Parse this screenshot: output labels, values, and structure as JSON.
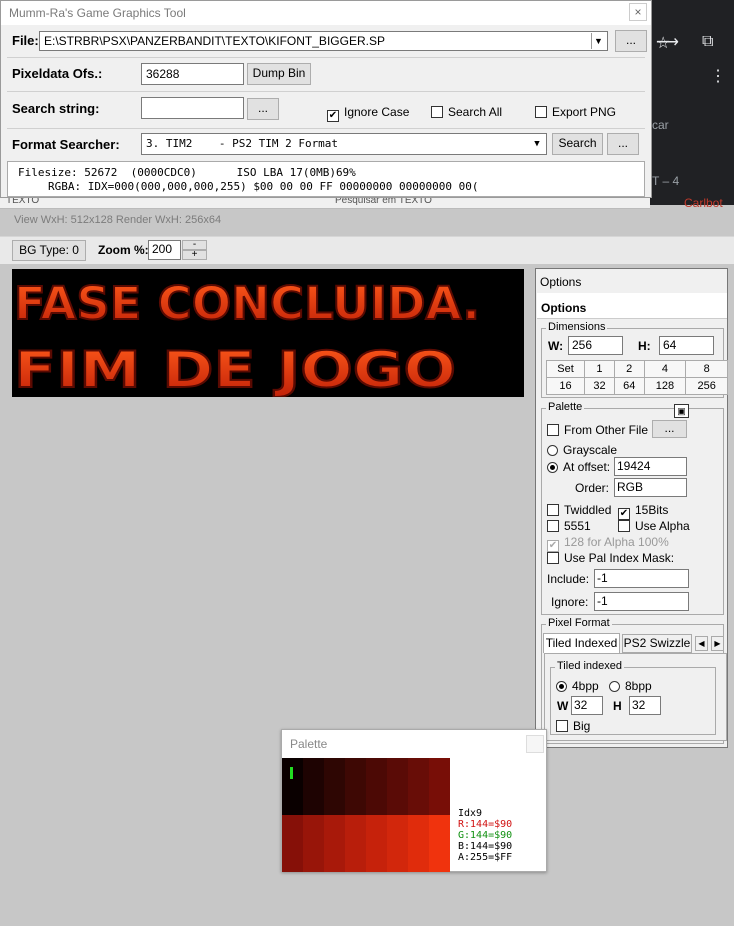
{
  "browser": {
    "tab_text_1": "car",
    "tab_text_2": "T – 4",
    "tab_text_3": "Carlbot",
    "address_label": "TEXTO",
    "search_placeholder": "Pesquisar em TEXTO"
  },
  "window": {
    "title": "Mumm-Ra's Game Graphics Tool",
    "close": "×"
  },
  "file": {
    "label": "File:",
    "path": "E:\\STRBR\\PSX\\PANZERBANDIT\\TEXTO\\KIFONT_BIGGER.SP",
    "browse": "..."
  },
  "pixeldata": {
    "label": "Pixeldata Ofs.:",
    "value": "36288",
    "dump_button": "Dump Bin"
  },
  "search": {
    "label": "Search string:",
    "value": "",
    "browse": "...",
    "ignore_case": "Ignore Case",
    "search_all": "Search All",
    "export_png": "Export PNG"
  },
  "format": {
    "label": "Format Searcher:",
    "selected": "3. TIM2    - PS2 TIM 2 Format",
    "search_button": "Search",
    "more": "..."
  },
  "info": {
    "filesize_label": "Filesize:",
    "filesize_value": "52672",
    "filesize_hex": "(0000CDC0)",
    "iso_label": "ISO LBA",
    "iso_value": "17(0MB)",
    "percent": "69%",
    "rgba_label": "RGBA:",
    "rgba_value": "IDX=000(000,000,000,255) $00 00 00 FF 00000000 00000000 00("
  },
  "view": {
    "size_label": "View WxH: 512x128 Render WxH: 256x64",
    "bg_type": "BG Type: 0",
    "zoom_label": "Zoom %:",
    "zoom_value": "200",
    "zoom_minus": "-",
    "zoom_plus": "+",
    "line1": "FASE CONCLUIDA.",
    "line2": "FIM DE JOGO"
  },
  "options": {
    "title": "Options",
    "header": "Options",
    "dimensions": {
      "title": "Dimensions",
      "w_label": "W:",
      "w_value": "256",
      "h_label": "H:",
      "h_value": "64",
      "set_row": [
        "Set",
        "1",
        "2",
        "4",
        "8"
      ],
      "size_row": [
        "16",
        "32",
        "64",
        "128",
        "256"
      ]
    },
    "palette": {
      "title": "Palette",
      "from_other_file": "From Other File",
      "browse": "...",
      "grayscale": "Grayscale",
      "at_offset": "At offset:",
      "offset_value": "19424",
      "order_label": "Order:",
      "order_value": "RGB",
      "twiddled": "Twiddled",
      "bits15": "15Bits",
      "b5551": "5551",
      "use_alpha": "Use Alpha",
      "alpha128": "128 for Alpha 100%",
      "pal_index_mask": "Use Pal Index Mask:",
      "include_label": "Include:",
      "include_value": "-1",
      "ignore_label": "Ignore:",
      "ignore_value": "-1"
    },
    "pixel_format": {
      "title": "Pixel Format",
      "tab_tiled": "Tiled Indexed",
      "tab_swizzle": "PS2 Swizzle",
      "tiled_title": "Tiled indexed",
      "bpp4": "4bpp",
      "bpp8": "8bpp",
      "w_label": "W",
      "w_value": "32",
      "h_label": "H",
      "h_value": "32",
      "big": "Big"
    }
  },
  "palette_window": {
    "title": "Palette",
    "idx": "Idx9",
    "r": "R:144=$90",
    "g": "G:144=$90",
    "b": "B:144=$90",
    "a": "A:255=$FF",
    "colors": [
      "#0a0000",
      "#1e0302",
      "#2e0603",
      "#3e0804",
      "#4c0905",
      "#5a0b06",
      "#680d07",
      "#780e07",
      "#861008",
      "#981509",
      "#a8190a",
      "#b81e0b",
      "#c6220b",
      "#d2270c",
      "#e02c0c",
      "#f0330d"
    ]
  }
}
